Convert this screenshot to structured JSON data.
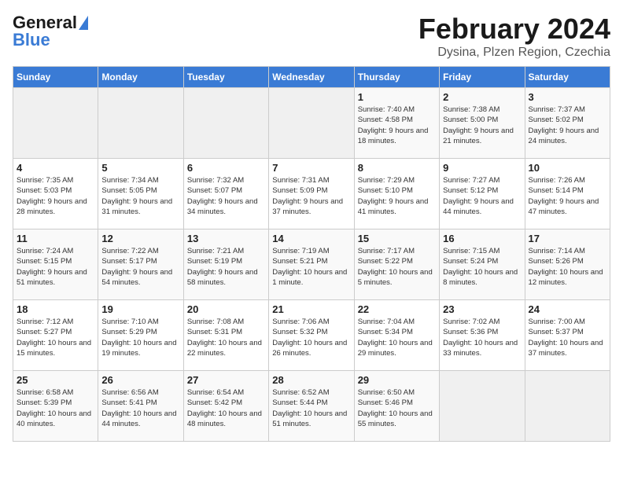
{
  "logo": {
    "text_general": "General",
    "text_blue": "Blue"
  },
  "title": "February 2024",
  "subtitle": "Dysina, Plzen Region, Czechia",
  "headers": [
    "Sunday",
    "Monday",
    "Tuesday",
    "Wednesday",
    "Thursday",
    "Friday",
    "Saturday"
  ],
  "weeks": [
    [
      {
        "day": "",
        "sunrise": "",
        "sunset": "",
        "daylight": "",
        "empty": true
      },
      {
        "day": "",
        "sunrise": "",
        "sunset": "",
        "daylight": "",
        "empty": true
      },
      {
        "day": "",
        "sunrise": "",
        "sunset": "",
        "daylight": "",
        "empty": true
      },
      {
        "day": "",
        "sunrise": "",
        "sunset": "",
        "daylight": "",
        "empty": true
      },
      {
        "day": "1",
        "sunrise": "Sunrise: 7:40 AM",
        "sunset": "Sunset: 4:58 PM",
        "daylight": "Daylight: 9 hours and 18 minutes.",
        "empty": false
      },
      {
        "day": "2",
        "sunrise": "Sunrise: 7:38 AM",
        "sunset": "Sunset: 5:00 PM",
        "daylight": "Daylight: 9 hours and 21 minutes.",
        "empty": false
      },
      {
        "day": "3",
        "sunrise": "Sunrise: 7:37 AM",
        "sunset": "Sunset: 5:02 PM",
        "daylight": "Daylight: 9 hours and 24 minutes.",
        "empty": false
      }
    ],
    [
      {
        "day": "4",
        "sunrise": "Sunrise: 7:35 AM",
        "sunset": "Sunset: 5:03 PM",
        "daylight": "Daylight: 9 hours and 28 minutes.",
        "empty": false
      },
      {
        "day": "5",
        "sunrise": "Sunrise: 7:34 AM",
        "sunset": "Sunset: 5:05 PM",
        "daylight": "Daylight: 9 hours and 31 minutes.",
        "empty": false
      },
      {
        "day": "6",
        "sunrise": "Sunrise: 7:32 AM",
        "sunset": "Sunset: 5:07 PM",
        "daylight": "Daylight: 9 hours and 34 minutes.",
        "empty": false
      },
      {
        "day": "7",
        "sunrise": "Sunrise: 7:31 AM",
        "sunset": "Sunset: 5:09 PM",
        "daylight": "Daylight: 9 hours and 37 minutes.",
        "empty": false
      },
      {
        "day": "8",
        "sunrise": "Sunrise: 7:29 AM",
        "sunset": "Sunset: 5:10 PM",
        "daylight": "Daylight: 9 hours and 41 minutes.",
        "empty": false
      },
      {
        "day": "9",
        "sunrise": "Sunrise: 7:27 AM",
        "sunset": "Sunset: 5:12 PM",
        "daylight": "Daylight: 9 hours and 44 minutes.",
        "empty": false
      },
      {
        "day": "10",
        "sunrise": "Sunrise: 7:26 AM",
        "sunset": "Sunset: 5:14 PM",
        "daylight": "Daylight: 9 hours and 47 minutes.",
        "empty": false
      }
    ],
    [
      {
        "day": "11",
        "sunrise": "Sunrise: 7:24 AM",
        "sunset": "Sunset: 5:15 PM",
        "daylight": "Daylight: 9 hours and 51 minutes.",
        "empty": false
      },
      {
        "day": "12",
        "sunrise": "Sunrise: 7:22 AM",
        "sunset": "Sunset: 5:17 PM",
        "daylight": "Daylight: 9 hours and 54 minutes.",
        "empty": false
      },
      {
        "day": "13",
        "sunrise": "Sunrise: 7:21 AM",
        "sunset": "Sunset: 5:19 PM",
        "daylight": "Daylight: 9 hours and 58 minutes.",
        "empty": false
      },
      {
        "day": "14",
        "sunrise": "Sunrise: 7:19 AM",
        "sunset": "Sunset: 5:21 PM",
        "daylight": "Daylight: 10 hours and 1 minute.",
        "empty": false
      },
      {
        "day": "15",
        "sunrise": "Sunrise: 7:17 AM",
        "sunset": "Sunset: 5:22 PM",
        "daylight": "Daylight: 10 hours and 5 minutes.",
        "empty": false
      },
      {
        "day": "16",
        "sunrise": "Sunrise: 7:15 AM",
        "sunset": "Sunset: 5:24 PM",
        "daylight": "Daylight: 10 hours and 8 minutes.",
        "empty": false
      },
      {
        "day": "17",
        "sunrise": "Sunrise: 7:14 AM",
        "sunset": "Sunset: 5:26 PM",
        "daylight": "Daylight: 10 hours and 12 minutes.",
        "empty": false
      }
    ],
    [
      {
        "day": "18",
        "sunrise": "Sunrise: 7:12 AM",
        "sunset": "Sunset: 5:27 PM",
        "daylight": "Daylight: 10 hours and 15 minutes.",
        "empty": false
      },
      {
        "day": "19",
        "sunrise": "Sunrise: 7:10 AM",
        "sunset": "Sunset: 5:29 PM",
        "daylight": "Daylight: 10 hours and 19 minutes.",
        "empty": false
      },
      {
        "day": "20",
        "sunrise": "Sunrise: 7:08 AM",
        "sunset": "Sunset: 5:31 PM",
        "daylight": "Daylight: 10 hours and 22 minutes.",
        "empty": false
      },
      {
        "day": "21",
        "sunrise": "Sunrise: 7:06 AM",
        "sunset": "Sunset: 5:32 PM",
        "daylight": "Daylight: 10 hours and 26 minutes.",
        "empty": false
      },
      {
        "day": "22",
        "sunrise": "Sunrise: 7:04 AM",
        "sunset": "Sunset: 5:34 PM",
        "daylight": "Daylight: 10 hours and 29 minutes.",
        "empty": false
      },
      {
        "day": "23",
        "sunrise": "Sunrise: 7:02 AM",
        "sunset": "Sunset: 5:36 PM",
        "daylight": "Daylight: 10 hours and 33 minutes.",
        "empty": false
      },
      {
        "day": "24",
        "sunrise": "Sunrise: 7:00 AM",
        "sunset": "Sunset: 5:37 PM",
        "daylight": "Daylight: 10 hours and 37 minutes.",
        "empty": false
      }
    ],
    [
      {
        "day": "25",
        "sunrise": "Sunrise: 6:58 AM",
        "sunset": "Sunset: 5:39 PM",
        "daylight": "Daylight: 10 hours and 40 minutes.",
        "empty": false
      },
      {
        "day": "26",
        "sunrise": "Sunrise: 6:56 AM",
        "sunset": "Sunset: 5:41 PM",
        "daylight": "Daylight: 10 hours and 44 minutes.",
        "empty": false
      },
      {
        "day": "27",
        "sunrise": "Sunrise: 6:54 AM",
        "sunset": "Sunset: 5:42 PM",
        "daylight": "Daylight: 10 hours and 48 minutes.",
        "empty": false
      },
      {
        "day": "28",
        "sunrise": "Sunrise: 6:52 AM",
        "sunset": "Sunset: 5:44 PM",
        "daylight": "Daylight: 10 hours and 51 minutes.",
        "empty": false
      },
      {
        "day": "29",
        "sunrise": "Sunrise: 6:50 AM",
        "sunset": "Sunset: 5:46 PM",
        "daylight": "Daylight: 10 hours and 55 minutes.",
        "empty": false
      },
      {
        "day": "",
        "sunrise": "",
        "sunset": "",
        "daylight": "",
        "empty": true
      },
      {
        "day": "",
        "sunrise": "",
        "sunset": "",
        "daylight": "",
        "empty": true
      }
    ]
  ]
}
